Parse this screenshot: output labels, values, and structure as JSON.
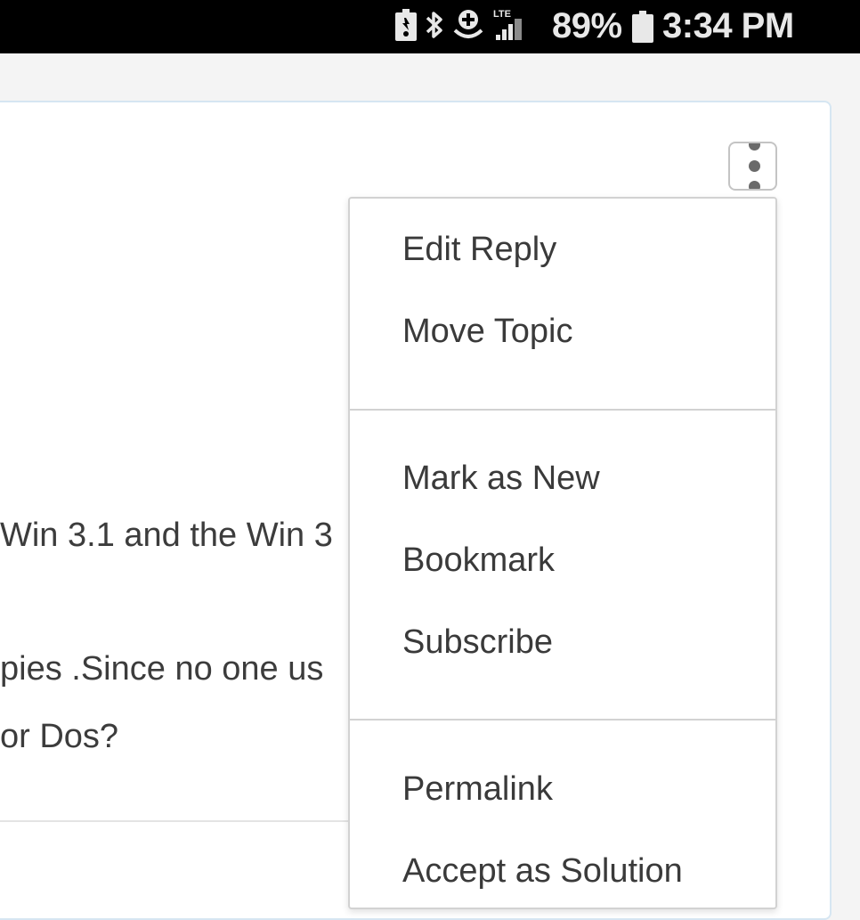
{
  "status_bar": {
    "battery_percent": "89%",
    "time": "3:34 PM",
    "network_label": "LTE",
    "icons": [
      "battery-saver-icon",
      "bluetooth-icon",
      "data-saver-icon",
      "lte-signal-icon",
      "battery-icon"
    ]
  },
  "post": {
    "lines": [
      "Win 3.1 and the Win 3",
      "pies .Since no one us",
      "or Dos?"
    ]
  },
  "menu": {
    "options_button_icon": "vertical-ellipsis-icon",
    "groups": [
      [
        "Edit Reply",
        "Move Topic"
      ],
      [
        "Mark as New",
        "Bookmark",
        "Subscribe"
      ],
      [
        "Permalink",
        "Accept as Solution"
      ]
    ]
  },
  "colors": {
    "status_bar_bg": "#000000",
    "page_bg": "#f4f4f4",
    "card_border": "#d6e6f2",
    "text": "#3a3a3a",
    "menu_border": "#d2d2d2"
  }
}
